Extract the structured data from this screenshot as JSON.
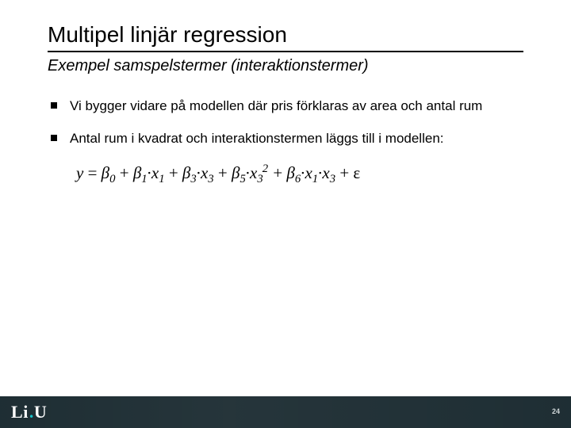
{
  "title": "Multipel linjär regression",
  "subtitle": "Exempel samspelstermer (interaktionstermer)",
  "bullets": [
    "Vi bygger vidare på modellen där pris förklaras av area och antal rum",
    "Antal rum i kvadrat och interaktionstermen läggs till i modellen:"
  ],
  "formula": {
    "y": "y",
    "eq": " = ",
    "b0": "β",
    "s0": "0",
    "plus": " + ",
    "b1": "β",
    "s1": "1",
    "dot": "∙",
    "x1": "x",
    "sx1": "1",
    "b3": "β",
    "s3": "3",
    "x3": "x",
    "sx3": "3",
    "b5": "β",
    "s5": "5",
    "x5": "x",
    "sx5": "3",
    "p2": "2",
    "b6": "β",
    "s6": "6",
    "x6a": "x",
    "sx6a": "1",
    "x6b": "x",
    "sx6b": "3",
    "eps": " + ε"
  },
  "footer": {
    "logo_l": "L",
    "logo_i": "i",
    "logo_dot": ".",
    "logo_u": "U",
    "page": "24"
  }
}
